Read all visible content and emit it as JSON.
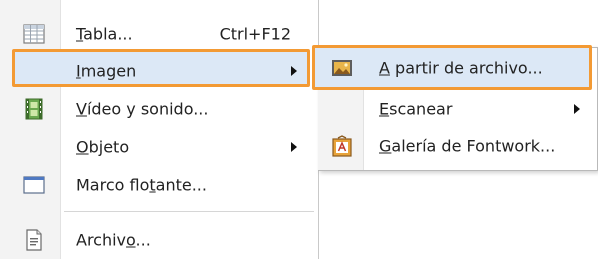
{
  "main_menu": {
    "items": [
      {
        "pre": "",
        "mn": "T",
        "post": "abla...",
        "accel": "Ctrl+F12",
        "icon": "table-icon"
      },
      {
        "pre": "",
        "mn": "I",
        "post": "magen",
        "accel": "",
        "icon": "",
        "has_submenu": true
      },
      {
        "pre": "",
        "mn": "V",
        "post": "ídeo y sonido...",
        "accel": "",
        "icon": "film-icon"
      },
      {
        "pre": "",
        "mn": "O",
        "post": "bjeto",
        "accel": "",
        "icon": "",
        "has_submenu": true
      },
      {
        "pre": "Marco flo",
        "mn": "t",
        "post": "ante...",
        "accel": "",
        "icon": "frame-icon"
      },
      {
        "pre": "Archiv",
        "mn": "o",
        "post": "...",
        "accel": "",
        "icon": "document-icon"
      }
    ]
  },
  "submenu": {
    "items": [
      {
        "pre": "",
        "mn": "A",
        "post": " partir de archivo...",
        "icon": "picture-icon"
      },
      {
        "pre": "",
        "mn": "E",
        "post": "scanear",
        "icon": "",
        "has_submenu": true
      },
      {
        "pre": "",
        "mn": "G",
        "post": "alería de Fontwork...",
        "icon": "fontwork-icon"
      }
    ]
  },
  "colors": {
    "highlight_border": "#f39a34",
    "hover_bg": "#dce8f6"
  }
}
